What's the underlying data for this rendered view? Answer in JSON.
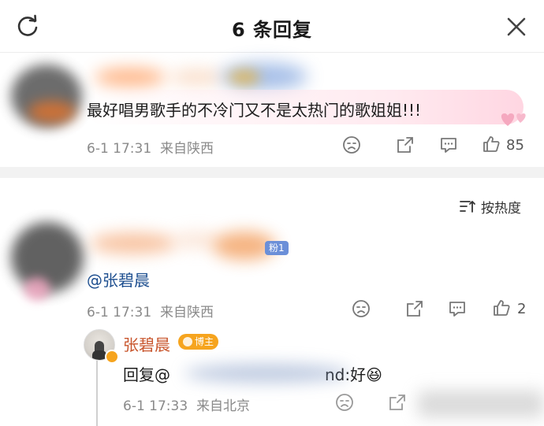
{
  "header": {
    "title": "6 条回复",
    "refresh_icon": "refresh-icon",
    "close_icon": "close-icon"
  },
  "top_comment": {
    "text": "最好唱男歌手的不冷门又不是太热门的歌姐姐!!!",
    "time": "6-1 17:31",
    "location": "来自陕西",
    "likes": "85"
  },
  "sort": {
    "label": "按热度"
  },
  "reply1": {
    "mention": "@张碧晨",
    "badge_partial": "粉1",
    "time": "6-1 17:31",
    "location": "来自陕西",
    "likes": "2"
  },
  "reply2": {
    "name": "张碧晨",
    "badge": "博主",
    "reply_prefix": "回复@",
    "reply_suffix": "nd:好",
    "emoji": "😆",
    "time": "6-1 17:33",
    "location": "来自北京"
  },
  "colors": {
    "accent_orange": "#c8552c",
    "mention_blue": "#1d4e8f",
    "meta_grey": "#8a8a8a",
    "divider": "#f2f2f2"
  }
}
